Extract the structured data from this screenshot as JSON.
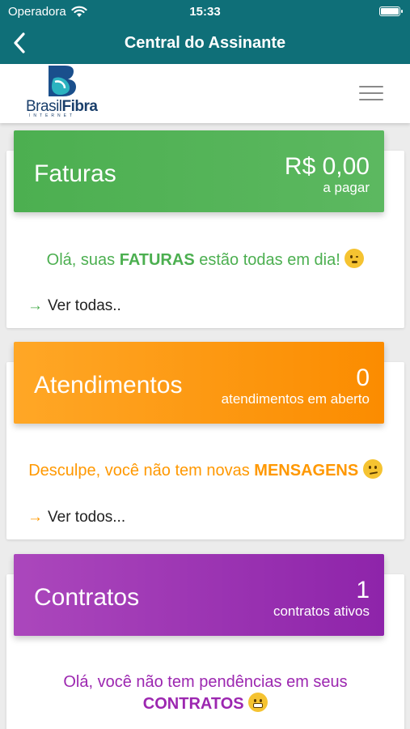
{
  "status_bar": {
    "carrier": "Operadora",
    "time": "15:33"
  },
  "nav": {
    "title": "Central do Assinante"
  },
  "brand": {
    "logo_text_a": "Brasil",
    "logo_text_b": "Fibra",
    "logo_sub": "INTERNET"
  },
  "cards": {
    "faturas": {
      "title": "Faturas",
      "value": "R$ 0,00",
      "sub": "a pagar",
      "msg_prefix": "Olá, suas ",
      "msg_strong": "FATURAS",
      "msg_suffix": " estão todas em dia! ",
      "link": "Ver todas..",
      "color": "#4caf50"
    },
    "atendimentos": {
      "title": "Atendimentos",
      "value": "0",
      "sub": "atendimentos em aberto",
      "msg_prefix": "Desculpe, você não tem novas ",
      "msg_strong": "MENSAGENS",
      "link": "Ver todos...",
      "color": "#ff9800"
    },
    "contratos": {
      "title": "Contratos",
      "value": "1",
      "sub": "contratos ativos",
      "msg_line1": "Olá, você não tem pendências em seus",
      "msg_strong": "CONTRATOS",
      "color": "#9c27b0"
    }
  }
}
